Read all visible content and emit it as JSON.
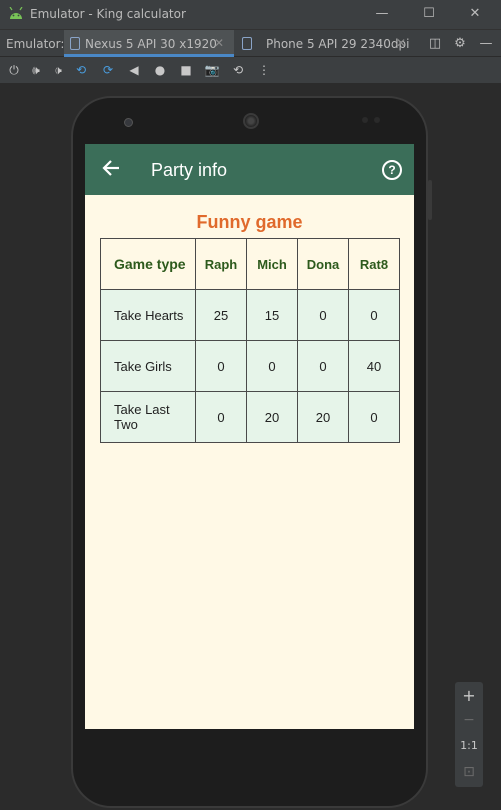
{
  "window": {
    "title": "Emulator - King calculator"
  },
  "tabs_bar": {
    "label": "Emulator:",
    "tabs": [
      {
        "label": "Nexus 5 API 30 x1920",
        "active": true
      },
      {
        "label": "Phone 5 API 29 2340dpi",
        "active": false
      }
    ]
  },
  "app": {
    "appbar_title": "Party info",
    "appbar_color": "#3b6e59",
    "game_title": "Funny game",
    "game_title_color": "#e06a2c",
    "table": {
      "header_first": "Game type",
      "players": [
        "Raph",
        "Mich",
        "Dona",
        "Rat8"
      ],
      "rows": [
        {
          "type": "Take Hearts",
          "scores": [
            "25",
            "15",
            "0",
            "0"
          ]
        },
        {
          "type": "Take Girls",
          "scores": [
            "0",
            "0",
            "0",
            "40"
          ]
        },
        {
          "type": "Take Last Two",
          "scores": [
            "0",
            "20",
            "20",
            "0"
          ]
        }
      ]
    }
  },
  "zoom": {
    "plus": "+",
    "minus": "−",
    "one_to_one": "1:1"
  }
}
